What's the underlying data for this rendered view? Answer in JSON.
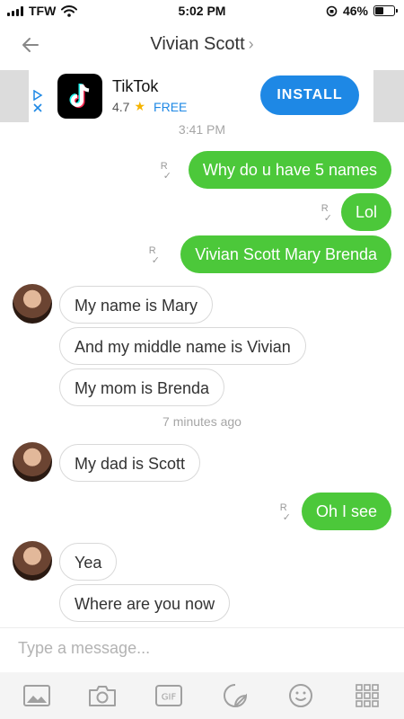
{
  "status": {
    "carrier": "TFW",
    "time": "5:02 PM",
    "battery": "46%",
    "battery_level": 0.46
  },
  "header": {
    "title": "Vivian Scott"
  },
  "ad": {
    "app_name": "TikTok",
    "rating": "4.7",
    "price": "FREE",
    "install_label": "INSTALL"
  },
  "messages": {
    "stamp1": "3:41 PM",
    "out1": "Why do u have 5 names",
    "out2": "Lol",
    "out3": "Vivian Scott Mary Brenda",
    "in1": "My name is Mary",
    "in2": "And my middle name is Vivian",
    "in3": "My mom is Brenda",
    "stamp2": "7 minutes ago",
    "in4": "My dad is Scott",
    "out4": "Oh I see",
    "in5": "Yea",
    "in6": "Where are you now"
  },
  "composer": {
    "placeholder": "Type a message..."
  },
  "colors": {
    "outgoing": "#4cc83a",
    "accent": "#1e88e5"
  }
}
